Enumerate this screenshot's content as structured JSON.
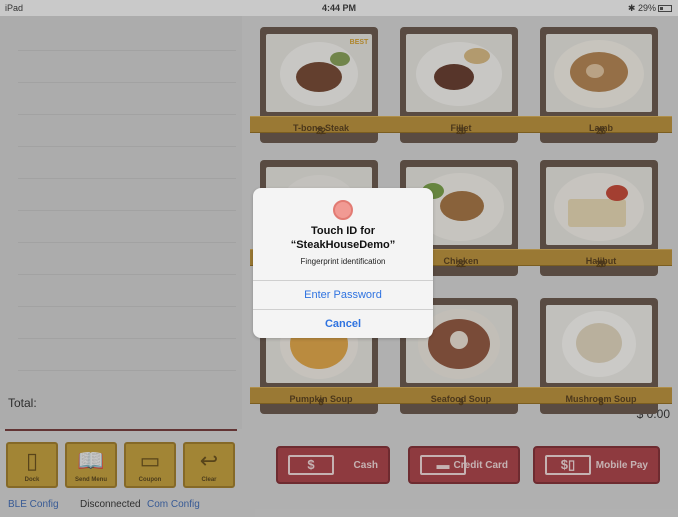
{
  "status_bar": {
    "device": "iPad",
    "time": "4:44 PM",
    "battery": "29%"
  },
  "order": {
    "total_label": "Total:",
    "total_amount": "$ 0.00",
    "tools": [
      {
        "label": "Dock",
        "icon": "tablet-icon"
      },
      {
        "label": "Send Menu",
        "icon": "book-icon"
      },
      {
        "label": "Coupon",
        "icon": "coupon-icon"
      },
      {
        "label": "Clear",
        "icon": "undo-arrow-icon"
      }
    ],
    "ble_config": "BLE Config",
    "connection_status": "Disconnected",
    "com_config": "Com Config"
  },
  "menu": [
    {
      "name": "T-bone Steak",
      "currency": "$",
      "price": "22",
      "badge": "BEST"
    },
    {
      "name": "Fillet",
      "currency": "$",
      "price": "25"
    },
    {
      "name": "Lamb",
      "currency": "$",
      "price": "26"
    },
    {
      "name": "Chicken",
      "currency": "$",
      "price": "22"
    },
    {
      "name": "Halibut",
      "currency": "$",
      "price": "28"
    },
    {
      "name": "Pumpkin Soup",
      "currency": "$",
      "price": "8"
    },
    {
      "name": "Seafood Soup",
      "currency": "$",
      "price": "9"
    },
    {
      "name": "Mushroom Soup",
      "currency": "$",
      "price": "8"
    }
  ],
  "payment": {
    "cash": "Cash",
    "credit_card": "Credit Card",
    "mobile_pay": "Mobile Pay"
  },
  "alert": {
    "title": "Touch ID for",
    "app_name": "“SteakHouseDemo”",
    "subtitle": "Fingerprint identification",
    "enter_password": "Enter Password",
    "cancel": "Cancel"
  }
}
